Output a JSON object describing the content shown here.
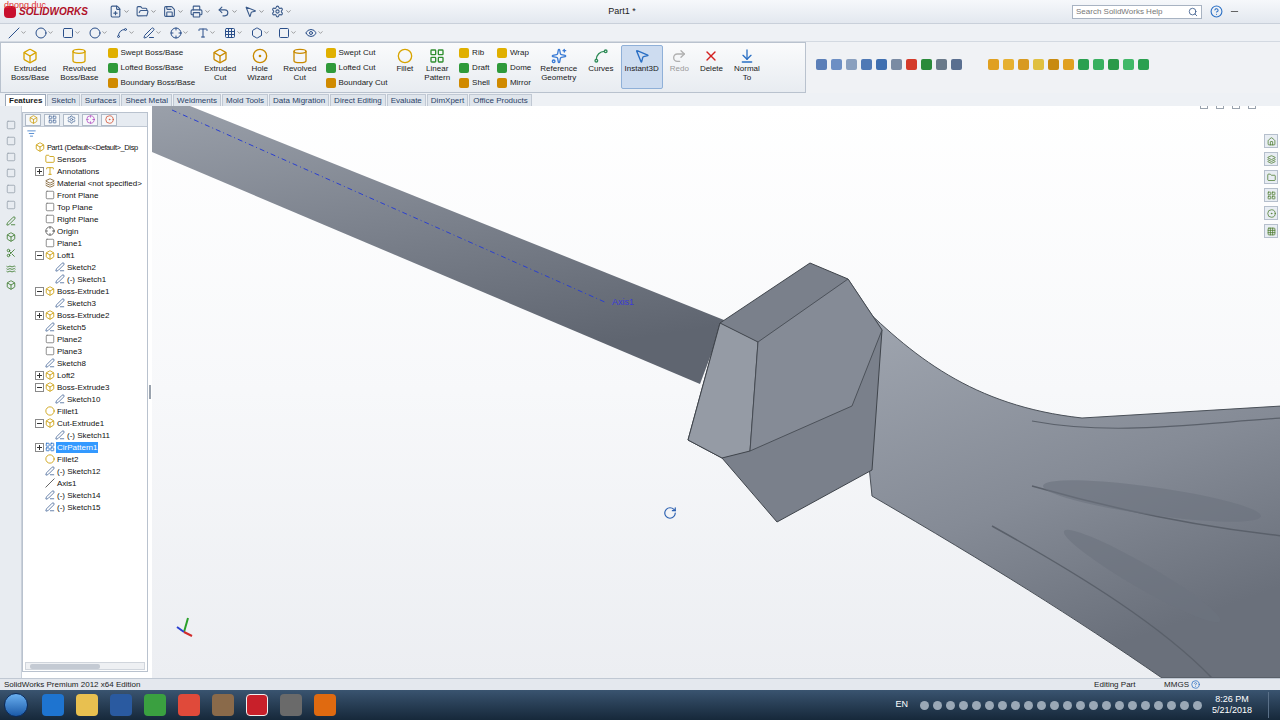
{
  "watermark": "dnong duc",
  "title_bar": {
    "logo": "SOLIDWORKS",
    "document": "Part1 *",
    "search": {
      "placeholder": "Search SolidWorks Help"
    }
  },
  "command_manager": {
    "columns": [
      {
        "kind": "large",
        "lines": [
          "Extruded",
          "Boss/Base"
        ],
        "selected": false,
        "disabled": false
      },
      {
        "kind": "large",
        "lines": [
          "Revolved",
          "Boss/Base"
        ],
        "selected": false,
        "disabled": false
      },
      {
        "kind": "stack",
        "items": [
          "Swept Boss/Base",
          "Lofted Boss/Base",
          "Boundary Boss/Base"
        ]
      },
      {
        "kind": "large",
        "lines": [
          "Extruded",
          "Cut"
        ],
        "selected": false,
        "disabled": false
      },
      {
        "kind": "large",
        "lines": [
          "Hole",
          "Wizard"
        ],
        "selected": false,
        "disabled": false
      },
      {
        "kind": "large",
        "lines": [
          "Revolved",
          "Cut"
        ],
        "selected": false,
        "disabled": false
      },
      {
        "kind": "stack",
        "items": [
          "Swept Cut",
          "Lofted Cut",
          "Boundary Cut"
        ]
      },
      {
        "kind": "large",
        "lines": [
          "Fillet"
        ],
        "selected": false,
        "disabled": false
      },
      {
        "kind": "large",
        "lines": [
          "Linear",
          "Pattern"
        ],
        "selected": false,
        "disabled": false
      },
      {
        "kind": "stack",
        "items": [
          "Rib",
          "Draft",
          "Shell"
        ]
      },
      {
        "kind": "stack",
        "items": [
          "Wrap",
          "Dome",
          "Mirror"
        ]
      },
      {
        "kind": "large",
        "lines": [
          "Reference",
          "Geometry"
        ],
        "selected": false,
        "disabled": false
      },
      {
        "kind": "large",
        "lines": [
          "Curves"
        ],
        "selected": false,
        "disabled": false
      },
      {
        "kind": "large",
        "lines": [
          "Instant3D"
        ],
        "selected": true,
        "disabled": false
      },
      {
        "kind": "large",
        "lines": [
          "Redo"
        ],
        "selected": false,
        "disabled": true
      },
      {
        "kind": "large",
        "lines": [
          "Delete"
        ],
        "selected": false,
        "disabled": false
      },
      {
        "kind": "large",
        "lines": [
          "Normal",
          "To"
        ],
        "selected": false,
        "disabled": false
      }
    ]
  },
  "tabs": [
    {
      "label": "Features",
      "selected": true
    },
    {
      "label": "Sketch",
      "selected": false
    },
    {
      "label": "Surfaces",
      "selected": false
    },
    {
      "label": "Sheet Metal",
      "selected": false
    },
    {
      "label": "Weldments",
      "selected": false
    },
    {
      "label": "Mold Tools",
      "selected": false
    },
    {
      "label": "Data Migration",
      "selected": false
    },
    {
      "label": "Direct Editing",
      "selected": false
    },
    {
      "label": "Evaluate",
      "selected": false
    },
    {
      "label": "DimXpert",
      "selected": false
    },
    {
      "label": "Office Products",
      "selected": false
    }
  ],
  "feature_tree": {
    "items": [
      {
        "label": "Part1  (Default<<Default>_Disp",
        "kind": "part",
        "indent": 0,
        "expandable": false,
        "expanded": false,
        "selected": false
      },
      {
        "label": "Sensors",
        "kind": "folder",
        "indent": 1,
        "expandable": false,
        "expanded": false,
        "selected": false
      },
      {
        "label": "Annotations",
        "kind": "annotation",
        "indent": 1,
        "expandable": true,
        "expanded": false,
        "selected": false
      },
      {
        "label": "Material <not specified>",
        "kind": "material",
        "indent": 1,
        "expandable": false,
        "expanded": false,
        "selected": false
      },
      {
        "label": "Front Plane",
        "kind": "plane",
        "indent": 1,
        "expandable": false,
        "expanded": false,
        "selected": false
      },
      {
        "label": "Top Plane",
        "kind": "plane",
        "indent": 1,
        "expandable": false,
        "expanded": false,
        "selected": false
      },
      {
        "label": "Right Plane",
        "kind": "plane",
        "indent": 1,
        "expandable": false,
        "expanded": false,
        "selected": false
      },
      {
        "label": "Origin",
        "kind": "origin",
        "indent": 1,
        "expandable": false,
        "expanded": false,
        "selected": false
      },
      {
        "label": "Plane1",
        "kind": "plane",
        "indent": 1,
        "expandable": false,
        "expanded": false,
        "selected": false
      },
      {
        "label": "Loft1",
        "kind": "feature",
        "indent": 1,
        "expandable": true,
        "expanded": true,
        "selected": false
      },
      {
        "label": "Sketch2",
        "kind": "sketch",
        "indent": 2,
        "expandable": false,
        "expanded": false,
        "selected": false
      },
      {
        "label": "(-) Sketch1",
        "kind": "sketch",
        "indent": 2,
        "expandable": false,
        "expanded": false,
        "selected": false
      },
      {
        "label": "Boss-Extrude1",
        "kind": "feature",
        "indent": 1,
        "expandable": true,
        "expanded": true,
        "selected": false
      },
      {
        "label": "Sketch3",
        "kind": "sketch",
        "indent": 2,
        "expandable": false,
        "expanded": false,
        "selected": false
      },
      {
        "label": "Boss-Extrude2",
        "kind": "feature",
        "indent": 1,
        "expandable": true,
        "expanded": false,
        "selected": false
      },
      {
        "label": "Sketch5",
        "kind": "sketch",
        "indent": 1,
        "expandable": false,
        "expanded": false,
        "selected": false
      },
      {
        "label": "Plane2",
        "kind": "plane",
        "indent": 1,
        "expandable": false,
        "expanded": false,
        "selected": false
      },
      {
        "label": "Plane3",
        "kind": "plane",
        "indent": 1,
        "expandable": false,
        "expanded": false,
        "selected": false
      },
      {
        "label": "Sketch8",
        "kind": "sketch",
        "indent": 1,
        "expandable": false,
        "expanded": false,
        "selected": false
      },
      {
        "label": "Loft2",
        "kind": "feature",
        "indent": 1,
        "expandable": true,
        "expanded": false,
        "selected": false
      },
      {
        "label": "Boss-Extrude3",
        "kind": "feature",
        "indent": 1,
        "expandable": true,
        "expanded": true,
        "selected": false
      },
      {
        "label": "Sketch10",
        "kind": "sketch",
        "indent": 2,
        "expandable": false,
        "expanded": false,
        "selected": false
      },
      {
        "label": "Fillet1",
        "kind": "fillet",
        "indent": 1,
        "expandable": false,
        "expanded": false,
        "selected": false
      },
      {
        "label": "Cut-Extrude1",
        "kind": "feature",
        "indent": 1,
        "expandable": true,
        "expanded": true,
        "selected": false
      },
      {
        "label": "(-) Sketch11",
        "kind": "sketch",
        "indent": 2,
        "expandable": false,
        "expanded": false,
        "selected": false
      },
      {
        "label": "CirPattern1",
        "kind": "pattern",
        "indent": 1,
        "expandable": true,
        "expanded": false,
        "selected": true
      },
      {
        "label": "Fillet2",
        "kind": "fillet",
        "indent": 1,
        "expandable": false,
        "expanded": false,
        "selected": false
      },
      {
        "label": "(-) Sketch12",
        "kind": "sketch",
        "indent": 1,
        "expandable": false,
        "expanded": false,
        "selected": false
      },
      {
        "label": "Axis1",
        "kind": "axis",
        "indent": 1,
        "expandable": false,
        "expanded": false,
        "selected": false
      },
      {
        "label": "(-) Sketch14",
        "kind": "sketch",
        "indent": 1,
        "expandable": false,
        "expanded": false,
        "selected": false
      },
      {
        "label": "(-) Sketch15",
        "kind": "sketch",
        "indent": 1,
        "expandable": false,
        "expanded": false,
        "selected": false
      }
    ]
  },
  "viewport": {
    "axis_label": "Axis1"
  },
  "status_bar": {
    "edition": "SolidWorks Premium 2012 x64 Edition",
    "mode": "Editing Part",
    "units": "MMGS"
  },
  "taskbar": {
    "language": "EN",
    "time": "8:26 PM",
    "date": "5/21/2018"
  }
}
